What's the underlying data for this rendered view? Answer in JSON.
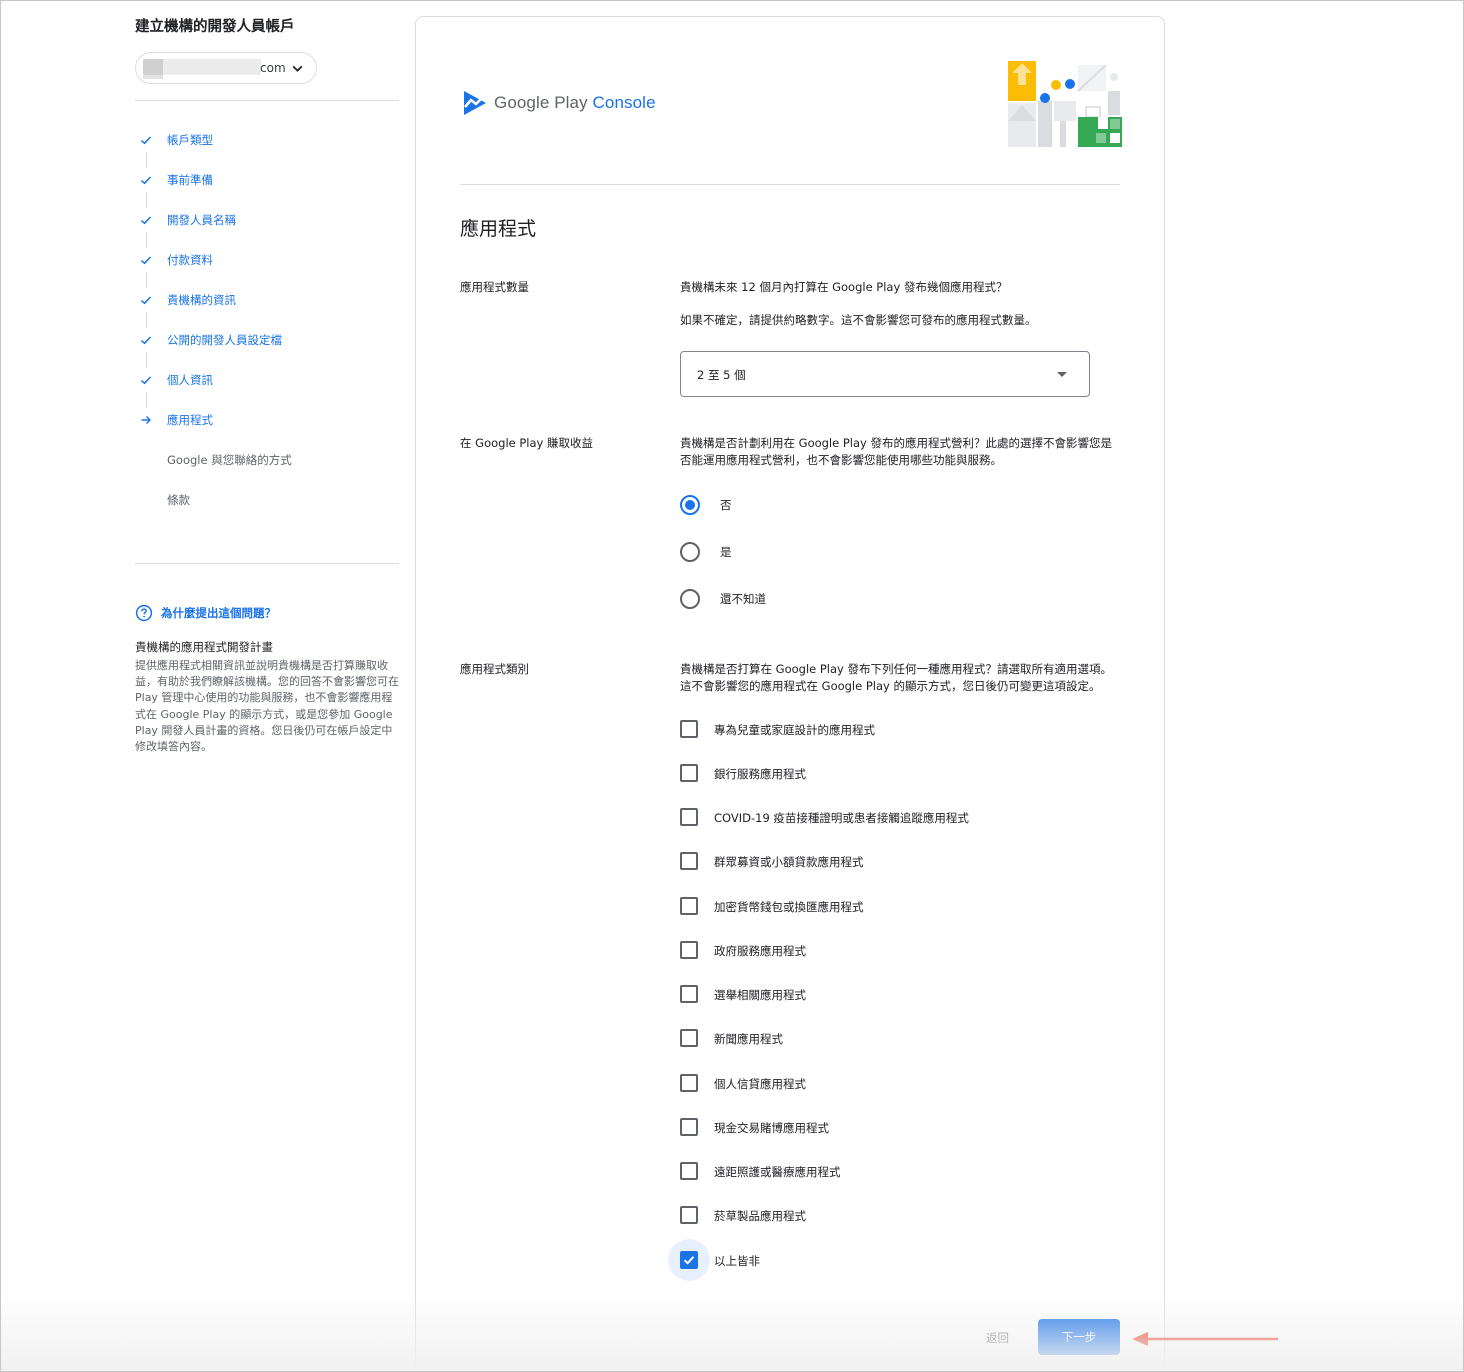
{
  "sidebar": {
    "title": "建立機構的開發人員帳戶",
    "account_suffix": "com",
    "steps": [
      {
        "label": "帳戶類型",
        "state": "done",
        "icon": "check-icon"
      },
      {
        "label": "事前準備",
        "state": "done",
        "icon": "check-icon"
      },
      {
        "label": "開發人員名稱",
        "state": "done",
        "icon": "check-icon"
      },
      {
        "label": "付款資料",
        "state": "done",
        "icon": "check-icon"
      },
      {
        "label": "貴機構的資訊",
        "state": "done",
        "icon": "check-icon"
      },
      {
        "label": "公開的開發人員設定檔",
        "state": "done",
        "icon": "check-icon"
      },
      {
        "label": "個人資訊",
        "state": "done",
        "icon": "check-icon"
      },
      {
        "label": "應用程式",
        "state": "current",
        "icon": "arrow-right-icon"
      },
      {
        "label": "Google 與您聯絡的方式",
        "state": "pending"
      },
      {
        "label": "條款",
        "state": "pending"
      }
    ],
    "why_label": "為什麼提出這個問題？",
    "help_heading": "貴機構的應用程式開發計畫",
    "help_body": "提供應用程式相關資訊並說明貴機構是否打算賺取收益，有助於我們瞭解該機構。您的回答不會影響您可在 Play 管理中心使用的功能與服務，也不會影響應用程式在 Google Play 的顯示方式，或是您參加 Google Play 開發人員計畫的資格。您日後仍可在帳戶設定中修改填答內容。"
  },
  "logo": {
    "google_play": "Google Play",
    "console": "Console"
  },
  "section_title": "應用程式",
  "app_count": {
    "label": "應用程式數量",
    "question": "貴機構未來 12 個月內打算在 Google Play 發布幾個應用程式？",
    "hint": "如果不確定，請提供約略數字。這不會影響您可發布的應用程式數量。",
    "selected": "2 至 5 個"
  },
  "monetize": {
    "label": "在 Google Play 賺取收益",
    "question": "貴機構是否計劃利用在 Google Play 發布的應用程式營利？此處的選擇不會影響您是否能運用應用程式營利，也不會影響您能使用哪些功能與服務。",
    "options": [
      {
        "label": "否",
        "checked": true
      },
      {
        "label": "是",
        "checked": false
      },
      {
        "label": "還不知道",
        "checked": false
      }
    ]
  },
  "categories": {
    "label": "應用程式類別",
    "question": "貴機構是否打算在 Google Play 發布下列任何一種應用程式？請選取所有適用選項。這不會影響您的應用程式在 Google Play 的顯示方式，您日後仍可變更這項設定。",
    "options": [
      {
        "label": "專為兒童或家庭設計的應用程式",
        "checked": false
      },
      {
        "label": "銀行服務應用程式",
        "checked": false
      },
      {
        "label": "COVID-19 疫苗接種證明或患者接觸追蹤應用程式",
        "checked": false
      },
      {
        "label": "群眾募資或小額貸款應用程式",
        "checked": false
      },
      {
        "label": "加密貨幣錢包或換匯應用程式",
        "checked": false
      },
      {
        "label": "政府服務應用程式",
        "checked": false
      },
      {
        "label": "選舉相關應用程式",
        "checked": false
      },
      {
        "label": "新聞應用程式",
        "checked": false
      },
      {
        "label": "個人信貸應用程式",
        "checked": false
      },
      {
        "label": "現金交易賭博應用程式",
        "checked": false
      },
      {
        "label": "遠距照護或醫療應用程式",
        "checked": false
      },
      {
        "label": "菸草製品應用程式",
        "checked": false
      },
      {
        "label": "以上皆非",
        "checked": true
      }
    ]
  },
  "actions": {
    "back": "返回",
    "next": "下一步"
  },
  "colors": {
    "accent": "#1a73e8",
    "annotation_arrow": "#e8321c"
  }
}
